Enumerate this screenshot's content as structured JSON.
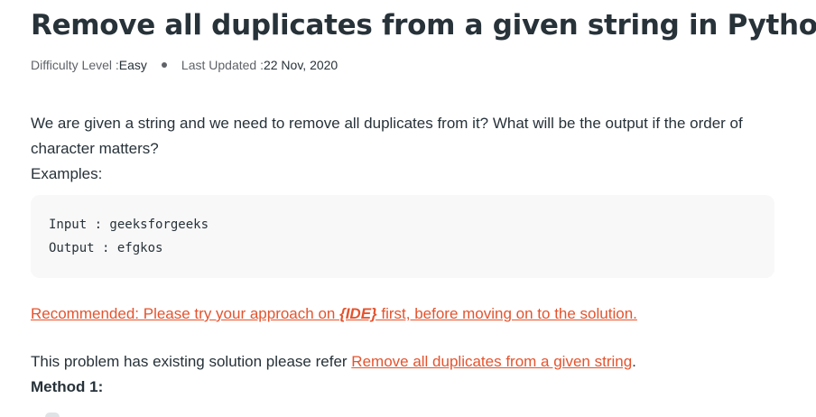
{
  "article": {
    "title": "Remove all duplicates from a given string in Python",
    "difficulty_label": "Difficulty Level : ",
    "difficulty_value": "Easy",
    "updated_label": "Last Updated : ",
    "updated_value": "22 Nov, 2020",
    "intro": "We are given a string and we need to remove all duplicates from it? What will be the output if the order of character matters?",
    "examples_label": "Examples:",
    "code_lines": [
      "Input : geeksforgeeks",
      "Output : efgkos"
    ],
    "recommended": {
      "prefix": "Recommended: Please try your approach on ",
      "ide": "{IDE}",
      "suffix": " first, before moving on to the solution."
    },
    "solution_text": "This problem has existing solution please refer ",
    "solution_link": "Remove all duplicates from a given string",
    "solution_end": ".",
    "method_heading": "Method 1:"
  },
  "colors": {
    "text": "#273239",
    "link": "#e5532d",
    "code_bg": "#f8f8f8"
  }
}
